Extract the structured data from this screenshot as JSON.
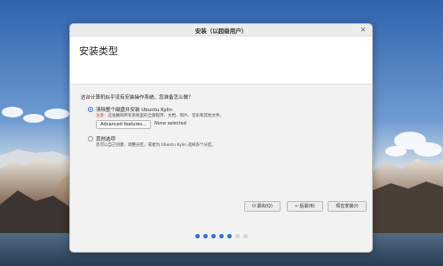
{
  "window": {
    "title": "安装（以超级用户）",
    "close_icon": "close-icon"
  },
  "header": {
    "title": "安装类型"
  },
  "main": {
    "question": "这台计算机似乎没有安装操作系统。您准备怎么做？",
    "options": [
      {
        "label": "清除整个磁盘并安装 Ubuntu Kylin",
        "selected": true,
        "note_prefix": "注意：",
        "note": "这会删除所有系统里的全部程序、文档、照片、音乐和其他文件。",
        "advanced_button": "Advanced features...",
        "advanced_status": "None selected"
      },
      {
        "label": "其他选项",
        "selected": false,
        "note": "您可以自己创建、调整分区，或者为 Ubuntu Kylin 选择多个分区。"
      }
    ]
  },
  "footer": {
    "quit": {
      "icon": "power-icon",
      "label": "退出(Q)"
    },
    "back": {
      "icon": "back-arrow-icon",
      "label": "后退(B)"
    },
    "install": {
      "label": "现在安装(I)"
    }
  },
  "progress": {
    "total_steps": 7,
    "completed_steps": 5,
    "active_color": "#2d6fd6",
    "inactive_color": "#d6d6d6"
  }
}
